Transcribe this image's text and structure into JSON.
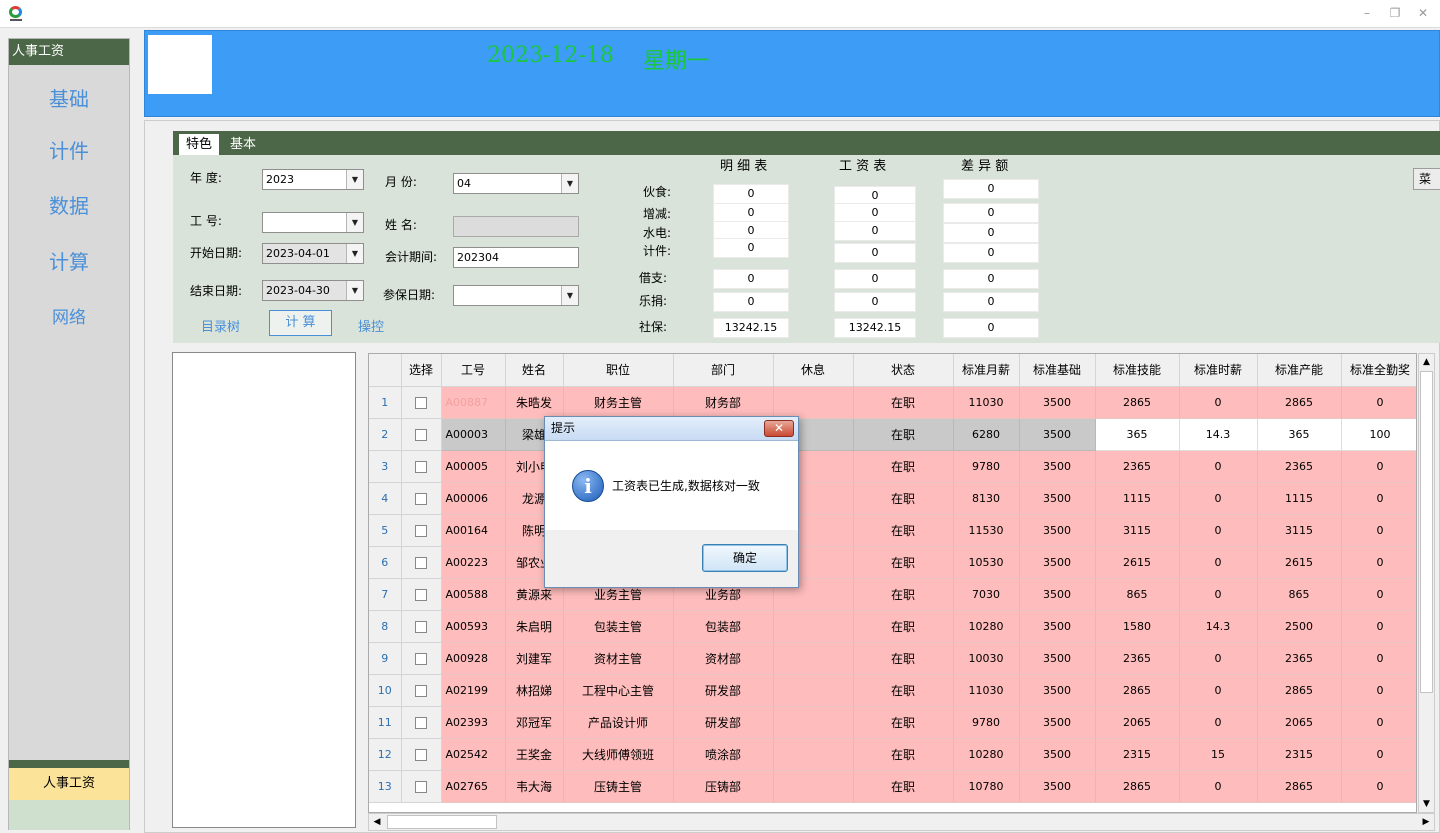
{
  "window": {
    "minimize": "–",
    "restore": "❐",
    "close": "✕"
  },
  "sidebar": {
    "header": "人事工资",
    "items": [
      "基础",
      "计件",
      "数据",
      "计算",
      "网络"
    ],
    "bottom_button": "人事工资"
  },
  "banner": {
    "date": "2023-12-18",
    "weekday": "星期一"
  },
  "tabs": [
    "特色",
    "基本"
  ],
  "form": {
    "year_label": "年    度:",
    "year_value": "2023",
    "month_label": "月    份:",
    "month_value": "04",
    "empno_label": "工    号:",
    "empno_value": "",
    "name_label": "姓    名:",
    "name_value": "",
    "start_label": "开始日期:",
    "start_value": "2023-04-01",
    "period_label": "会计期间:",
    "period_value": "202304",
    "end_label": "结束日期:",
    "end_value": "2023-04-30",
    "insure_label": "参保日期:",
    "insure_value": "",
    "tree_btn": "目录树",
    "calc_btn": "计    算",
    "ctrl_btn": "操控"
  },
  "summary": {
    "headers": [
      "明 细 表",
      "工 资 表",
      "差 异 额"
    ],
    "rows": [
      {
        "label": "伙食:",
        "detail": "0",
        "salary": "0",
        "diff": "0"
      },
      {
        "label": "增减:",
        "detail": "0",
        "salary": "0",
        "diff": "0"
      },
      {
        "label": "水电:",
        "detail": "0",
        "salary": "0",
        "diff": "0"
      },
      {
        "label": "计件:",
        "detail": "0",
        "salary": "0",
        "diff": "0"
      },
      {
        "label": "借支:",
        "detail": "0",
        "salary": "0",
        "diff": "0"
      },
      {
        "label": "乐捐:",
        "detail": "0",
        "salary": "0",
        "diff": "0"
      },
      {
        "label": "社保:",
        "detail": "13242.15",
        "salary": "13242.15",
        "diff": "0"
      }
    ],
    "menu_btn": "菜"
  },
  "grid": {
    "columns": [
      "",
      "选择",
      "工号",
      "姓名",
      "职位",
      "部门",
      "休息",
      "状态",
      "标准月薪",
      "标准基础",
      "标准技能",
      "标准时薪",
      "标准产能",
      "标准全勤奖"
    ],
    "rows": [
      {
        "n": "1",
        "id": "A00887",
        "name": "朱晧发",
        "pos": "财务主管",
        "dept": "财务部",
        "rest": "",
        "status": "在职",
        "monthly": "11030",
        "base": "3500",
        "skill": "2865",
        "hourly": "0",
        "capacity": "2865",
        "attend": "0"
      },
      {
        "n": "2",
        "id": "A00003",
        "name": "梁雄",
        "pos": "",
        "dept": "",
        "rest": "",
        "status": "在职",
        "monthly": "6280",
        "base": "3500",
        "skill": "365",
        "hourly": "14.3",
        "capacity": "365",
        "attend": "100"
      },
      {
        "n": "3",
        "id": "A00005",
        "name": "刘小申",
        "pos": "",
        "dept": "",
        "rest": "",
        "status": "在职",
        "monthly": "9780",
        "base": "3500",
        "skill": "2365",
        "hourly": "0",
        "capacity": "2365",
        "attend": "0"
      },
      {
        "n": "4",
        "id": "A00006",
        "name": "龙源",
        "pos": "",
        "dept": "",
        "rest": "",
        "status": "在职",
        "monthly": "8130",
        "base": "3500",
        "skill": "1115",
        "hourly": "0",
        "capacity": "1115",
        "attend": "0"
      },
      {
        "n": "5",
        "id": "A00164",
        "name": "陈明",
        "pos": "",
        "dept": "",
        "rest": "",
        "status": "在职",
        "monthly": "11530",
        "base": "3500",
        "skill": "3115",
        "hourly": "0",
        "capacity": "3115",
        "attend": "0"
      },
      {
        "n": "6",
        "id": "A00223",
        "name": "邹农业",
        "pos": "",
        "dept": "",
        "rest": "",
        "status": "在职",
        "monthly": "10530",
        "base": "3500",
        "skill": "2615",
        "hourly": "0",
        "capacity": "2615",
        "attend": "0"
      },
      {
        "n": "7",
        "id": "A00588",
        "name": "黄源来",
        "pos": "业务主管",
        "dept": "业务部",
        "rest": "",
        "status": "在职",
        "monthly": "7030",
        "base": "3500",
        "skill": "865",
        "hourly": "0",
        "capacity": "865",
        "attend": "0"
      },
      {
        "n": "8",
        "id": "A00593",
        "name": "朱启明",
        "pos": "包装主管",
        "dept": "包装部",
        "rest": "",
        "status": "在职",
        "monthly": "10280",
        "base": "3500",
        "skill": "1580",
        "hourly": "14.3",
        "capacity": "2500",
        "attend": "0"
      },
      {
        "n": "9",
        "id": "A00928",
        "name": "刘建军",
        "pos": "资材主管",
        "dept": "资材部",
        "rest": "",
        "status": "在职",
        "monthly": "10030",
        "base": "3500",
        "skill": "2365",
        "hourly": "0",
        "capacity": "2365",
        "attend": "0"
      },
      {
        "n": "10",
        "id": "A02199",
        "name": "林招娣",
        "pos": "工程中心主管",
        "dept": "研发部",
        "rest": "",
        "status": "在职",
        "monthly": "11030",
        "base": "3500",
        "skill": "2865",
        "hourly": "0",
        "capacity": "2865",
        "attend": "0"
      },
      {
        "n": "11",
        "id": "A02393",
        "name": "邓冠军",
        "pos": "产品设计师",
        "dept": "研发部",
        "rest": "",
        "status": "在职",
        "monthly": "9780",
        "base": "3500",
        "skill": "2065",
        "hourly": "0",
        "capacity": "2065",
        "attend": "0"
      },
      {
        "n": "12",
        "id": "A02542",
        "name": "王奖金",
        "pos": "大线师傅领班",
        "dept": "喷涂部",
        "rest": "",
        "status": "在职",
        "monthly": "10280",
        "base": "3500",
        "skill": "2315",
        "hourly": "15",
        "capacity": "2315",
        "attend": "0"
      },
      {
        "n": "13",
        "id": "A02765",
        "name": "韦大海",
        "pos": "压铸主管",
        "dept": "压铸部",
        "rest": "",
        "status": "在职",
        "monthly": "10780",
        "base": "3500",
        "skill": "2865",
        "hourly": "0",
        "capacity": "2865",
        "attend": "0"
      }
    ]
  },
  "dialog": {
    "title": "提示",
    "close": "✕",
    "icon": "i",
    "message": "工资表已生成,数据核对一致",
    "ok": "确定"
  }
}
